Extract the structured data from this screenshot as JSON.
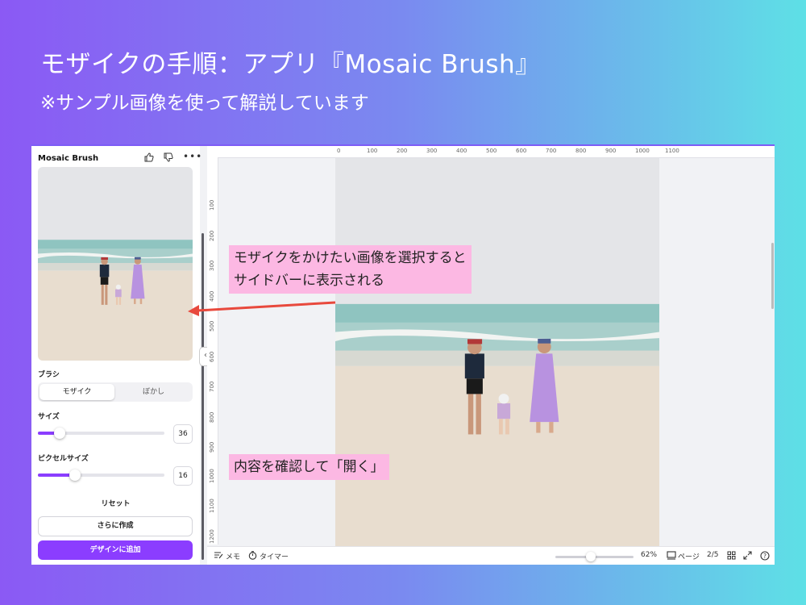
{
  "heading": {
    "title": "モザイクの手順：アプリ『Mosaic Brush』",
    "subtitle": "※サンプル画像を使って解説しています"
  },
  "panel": {
    "app_name": "Mosaic Brush",
    "brush_label": "ブラシ",
    "brush_options": [
      "モザイク",
      "ぼかし"
    ],
    "selected_brush": "モザイク",
    "size_label": "サイズ",
    "size_value": "36",
    "size_level": 0.17,
    "pixel_size_label": "ピクセルサイズ",
    "pixel_size_value": "16",
    "pixel_size_level": 0.29,
    "reset_label": "リセット",
    "create_more_label": "さらに作成",
    "add_to_design_label": "デザインに追加"
  },
  "ruler": {
    "top": [
      "0",
      "100",
      "200",
      "300",
      "400",
      "500",
      "600",
      "700",
      "800",
      "900",
      "1000",
      "1100"
    ],
    "left": [
      "100",
      "200",
      "300",
      "400",
      "500",
      "600",
      "700",
      "800",
      "900",
      "1000",
      "1100",
      "1200"
    ]
  },
  "bottom_bar": {
    "notes_label": "メモ",
    "timer_label": "タイマー",
    "zoom": "62%",
    "pages_label": "ページ",
    "page_indicator": "2/5"
  },
  "callouts": {
    "select_note": [
      "モザイクをかけたい画像を選択すると",
      "サイドバーに表示される"
    ],
    "open_note": "内容を確認して「開く」"
  },
  "colors": {
    "accent": "#8b3dff",
    "callout_bg": "#fcb8e3",
    "arrow": "#e8493d"
  },
  "icons": [
    "thumbs-up-icon",
    "thumbs-down-icon",
    "more-icon",
    "collapse-chevron-icon",
    "notes-icon",
    "timer-icon",
    "pages-icon",
    "grid-view-icon",
    "fullscreen-icon",
    "help-icon"
  ]
}
